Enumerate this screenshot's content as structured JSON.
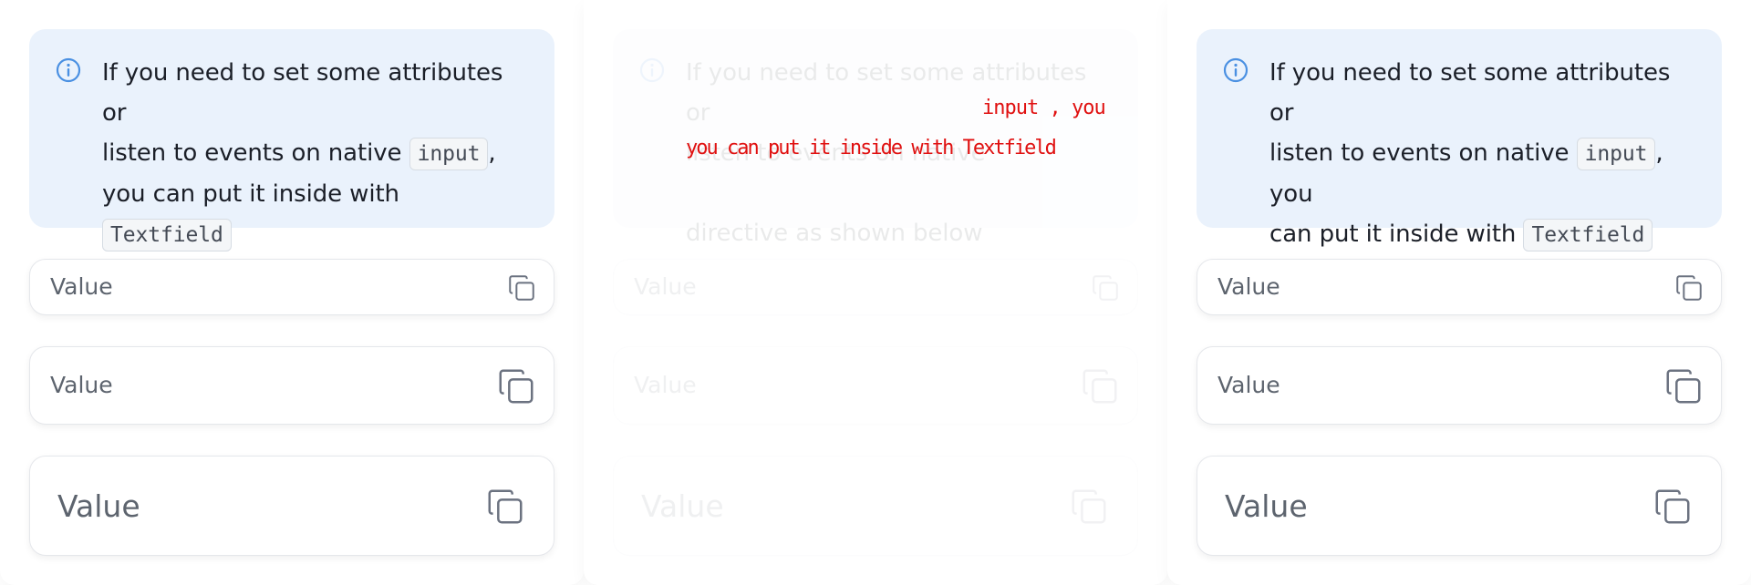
{
  "note": {
    "line1": "If you need to set some attributes or",
    "line2_pre": "listen to events on native",
    "code_input": "input",
    "line2_post": ",",
    "line3_pre": "you can put it inside with",
    "code_textfield": "Textfield",
    "line4": "directive as shown below",
    "alt_line2_post": ", you",
    "alt_line3_pre": "can put it inside with"
  },
  "fields": {
    "small_value": "Value",
    "medium_value": "Value",
    "large_value": "Value"
  },
  "glitch": {
    "line_a": "input , you",
    "line_b": "you can put it inside with Textfield"
  },
  "icons": {
    "info": "info-circle-icon",
    "copy": "copy-icon"
  },
  "colors": {
    "note_bg": "#eaf2fc",
    "info_icon": "#4a90e2",
    "glitch_text": "#e01010"
  }
}
